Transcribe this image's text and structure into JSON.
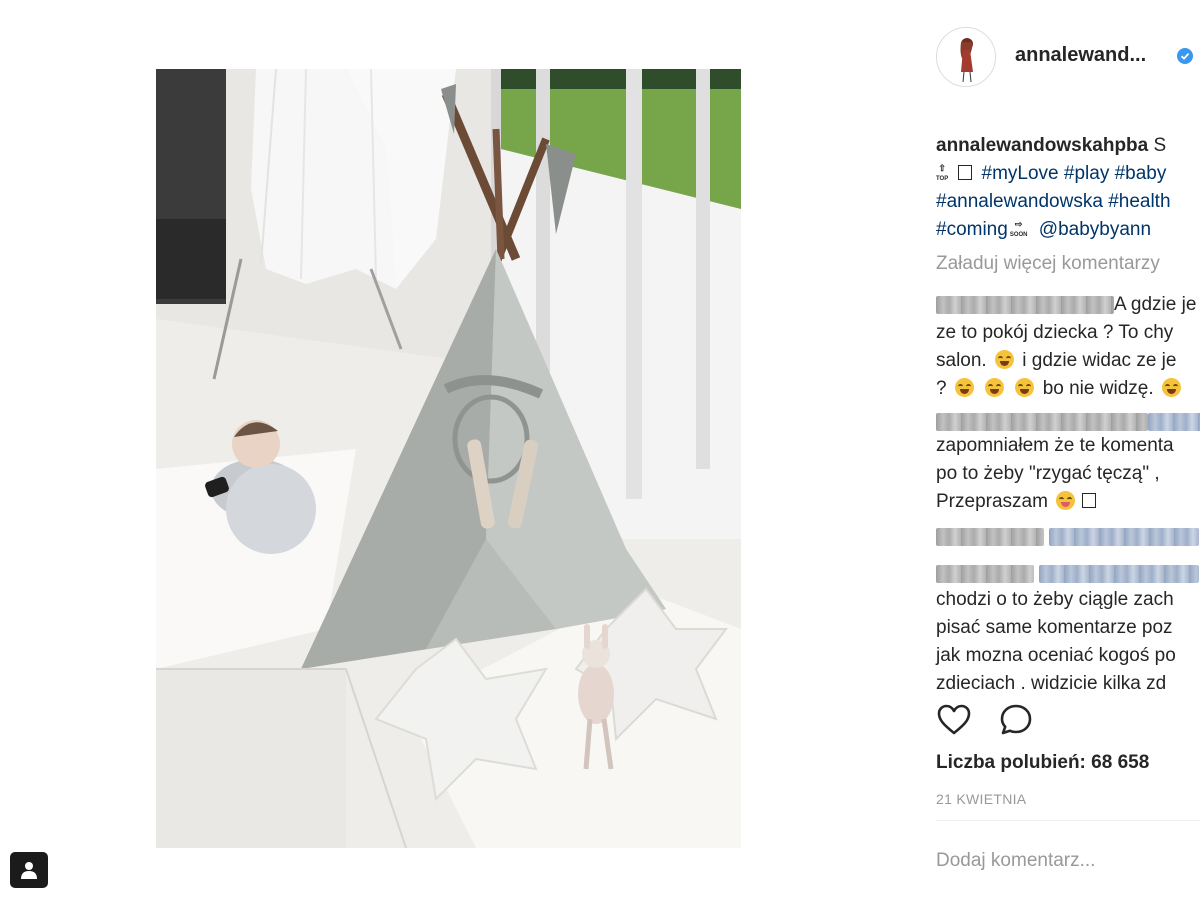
{
  "post": {
    "username_short": "annalewand...",
    "caption": {
      "username": "annalewandowskahpba",
      "text_start": "S",
      "line2_tags": [
        "#myLove",
        "#play",
        "#baby"
      ],
      "line3_tags": [
        "#annalewandowska",
        "#health"
      ],
      "line4_tag": "#coming",
      "line4_mention": "@babybyann",
      "top_glyph": "TOP",
      "soon_glyph": "SOON"
    },
    "load_more": "Załaduj więcej komentarzy",
    "comments": [
      {
        "line1": "A gdzie je",
        "line2": "ze to pokój dziecka ? To chy",
        "line3a": "salon.",
        "line3b": "i gdzie widac ze je",
        "line4a": "?",
        "line4b": "bo nie widzę."
      },
      {
        "line1": "zapomniałem że te komenta",
        "line2": "po to żeby \"rzygać tęczą\" ,",
        "line3": "Przepraszam"
      },
      {
        "line1": "chodzi o to żeby ciągle zach",
        "line2": "pisać same komentarze poz",
        "line3": "jak mozna oceniać kogoś po",
        "line4": "zdieciach . widzicie kilka zd"
      }
    ],
    "likes_label": "Liczba polubień: 68 658",
    "date": "21 KWIETNIA",
    "add_comment_placeholder": "Dodaj komentarz..."
  },
  "icons": {
    "verified": "verified-badge-icon",
    "like": "heart-icon",
    "comment": "comment-bubble-icon",
    "tag_people": "person-tag-icon",
    "more": "more-options-icon"
  },
  "colors": {
    "hashtag": "#003569",
    "muted": "#999999",
    "verified": "#3897f0"
  }
}
